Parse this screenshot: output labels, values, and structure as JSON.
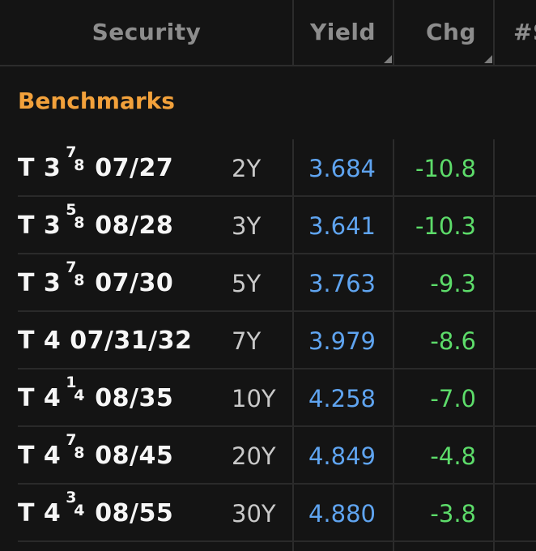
{
  "header": {
    "security": "Security",
    "yield": "Yield",
    "chg": "Chg",
    "extra": "#S"
  },
  "group": {
    "title": "Benchmarks"
  },
  "colors": {
    "group_title": "#f2a13b",
    "yield": "#5fa4f0",
    "chg": "#5ddc6a"
  },
  "rows": [
    {
      "prefix": "T 3",
      "frac_num": "7",
      "frac_den": "8",
      "suffix": "07/27",
      "tenor": "2Y",
      "yield": "3.684",
      "chg": "-10.8"
    },
    {
      "prefix": "T 3",
      "frac_num": "5",
      "frac_den": "8",
      "suffix": "08/28",
      "tenor": "3Y",
      "yield": "3.641",
      "chg": "-10.3"
    },
    {
      "prefix": "T 3",
      "frac_num": "7",
      "frac_den": "8",
      "suffix": "07/30",
      "tenor": "5Y",
      "yield": "3.763",
      "chg": "-9.3"
    },
    {
      "prefix": "T 4 07/31/32",
      "frac_num": "",
      "frac_den": "",
      "suffix": "",
      "tenor": "7Y",
      "yield": "3.979",
      "chg": "-8.6"
    },
    {
      "prefix": "T 4",
      "frac_num": "1",
      "frac_den": "4",
      "suffix": "08/35",
      "tenor": "10Y",
      "yield": "4.258",
      "chg": "-7.0"
    },
    {
      "prefix": "T 4",
      "frac_num": "7",
      "frac_den": "8",
      "suffix": "08/45",
      "tenor": "20Y",
      "yield": "4.849",
      "chg": "-4.8"
    },
    {
      "prefix": "T 4",
      "frac_num": "3",
      "frac_den": "4",
      "suffix": "08/55",
      "tenor": "30Y",
      "yield": "4.880",
      "chg": "-3.8"
    }
  ]
}
